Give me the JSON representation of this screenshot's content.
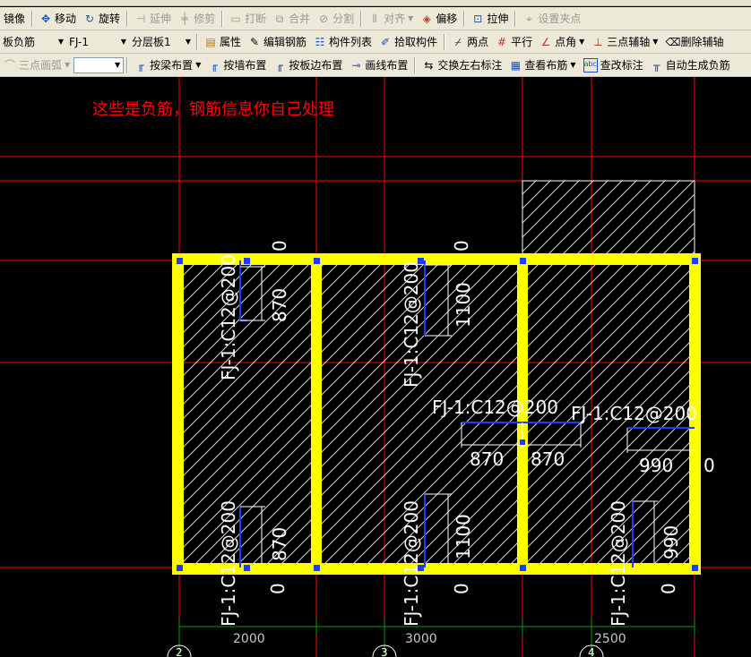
{
  "toolbar1": {
    "mirror": "镜像",
    "move": "移动",
    "rotate": "旋转",
    "extend": "延伸",
    "trim": "修剪",
    "break": "打断",
    "merge": "合并",
    "split": "分割",
    "align": "对齐",
    "offset": "偏移",
    "stretch": "拉伸",
    "set_grip": "设置夹点"
  },
  "toolbar2": {
    "category": "板负筋",
    "component": "FJ-1",
    "layer": "分层板1",
    "property": "属性",
    "edit_rebar": "编辑钢筋",
    "component_list": "构件列表",
    "pick_component": "拾取构件",
    "two_points": "两点",
    "parallel": "平行",
    "point_angle": "点角",
    "three_point_axis": "三点辅轴",
    "delete_axis": "删除辅轴"
  },
  "toolbar3": {
    "three_point_arc": "三点画弧",
    "arc_value": "",
    "by_beam": "按梁布置",
    "by_wall": "按墙布置",
    "by_slab_edge": "按板边布置",
    "draw_line": "画线布置",
    "swap_labels": "交换左右标注",
    "view_layout": "查看布筋",
    "check_labels": "查改标注",
    "auto_generate": "自动生成负筋"
  },
  "annotation": "这些是负筋，钢筋信息你自己处理",
  "rebar_label": "FJ-1:C12@200",
  "dims": {
    "top_left_zero": "0",
    "top_mid_zero": "0",
    "l1": "870",
    "l2": "1100",
    "l3": "870",
    "l4": "1100",
    "l5": "990",
    "h_left": "870",
    "h_right": "870",
    "h_r1": "990",
    "h_r2": "0",
    "bot_zero_1": "0",
    "bot_zero_2": "0",
    "bot_zero_3": "0"
  },
  "axis": {
    "span1": "2000",
    "span2": "3000",
    "span3": "2500",
    "bubble1": "2",
    "bubble2": "3",
    "bubble3": "4"
  },
  "colors": {
    "beam": "#ffff00",
    "grid": "#ff0000",
    "rebar": "#0000ff",
    "text": "#ffffff",
    "axis": "#00a000"
  }
}
